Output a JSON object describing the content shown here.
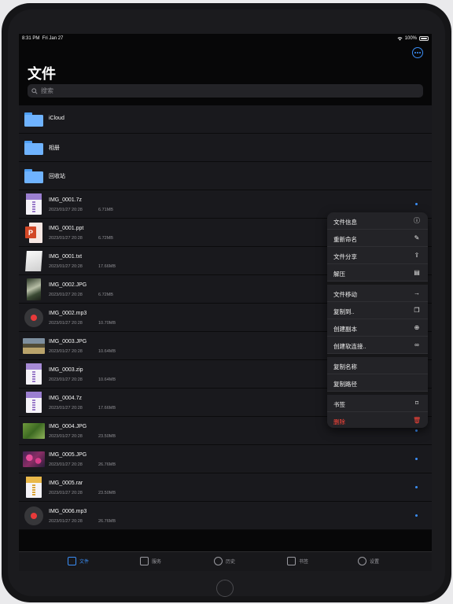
{
  "status_bar": {
    "time": "8:31 PM",
    "date": "Fri Jan 27",
    "battery": "100%"
  },
  "header": {
    "title": "文件",
    "more_icon": "ellipsis-circle-icon"
  },
  "search": {
    "placeholder": "搜索"
  },
  "folders": [
    {
      "name": "iCloud"
    },
    {
      "name": "相册"
    },
    {
      "name": "回收站"
    }
  ],
  "files": [
    {
      "name": "IMG_0001.7z",
      "date": "2023/01/27 20:28",
      "size": "6.71MB",
      "kind": "7z"
    },
    {
      "name": "IMG_0001.ppt",
      "date": "2023/01/27 20:28",
      "size": "6.72MB",
      "kind": "ppt"
    },
    {
      "name": "IMG_0001.txt",
      "date": "2023/01/27 20:28",
      "size": "17.66MB",
      "kind": "txt"
    },
    {
      "name": "IMG_0002.JPG",
      "date": "2023/01/27 20:28",
      "size": "6.72MB",
      "kind": "jpg-tall"
    },
    {
      "name": "IMG_0002.mp3",
      "date": "2023/01/27 20:28",
      "size": "10.70MB",
      "kind": "mp3"
    },
    {
      "name": "IMG_0003.JPG",
      "date": "2023/01/27 20:28",
      "size": "10.64MB",
      "kind": "jpg-landscape"
    },
    {
      "name": "IMG_0003.zip",
      "date": "2023/01/27 20:28",
      "size": "10.64MB",
      "kind": "zip"
    },
    {
      "name": "IMG_0004.7z",
      "date": "2023/01/27 20:28",
      "size": "17.66MB",
      "kind": "7z"
    },
    {
      "name": "IMG_0004.JPG",
      "date": "2023/01/27 20:28",
      "size": "23.50MB",
      "kind": "jpg-grass"
    },
    {
      "name": "IMG_0005.JPG",
      "date": "2023/01/27 20:28",
      "size": "26.76MB",
      "kind": "jpg-flowers"
    },
    {
      "name": "IMG_0005.rar",
      "date": "2023/01/27 20:28",
      "size": "23.50MB",
      "kind": "rar"
    },
    {
      "name": "IMG_0006.mp3",
      "date": "2023/01/27 20:28",
      "size": "26.76MB",
      "kind": "mp3"
    }
  ],
  "context_menu": {
    "groups": [
      [
        {
          "label": "文件信息",
          "icon": "info-circle-icon",
          "glyph": "ⓘ"
        },
        {
          "label": "重新命名",
          "icon": "rename-icon",
          "glyph": "✎"
        },
        {
          "label": "文件分享",
          "icon": "share-icon",
          "glyph": "⇪"
        },
        {
          "label": "解压",
          "icon": "archive-box-icon",
          "glyph": "▤"
        }
      ],
      [
        {
          "label": "文件移动",
          "icon": "arrow-right-icon",
          "glyph": "→"
        },
        {
          "label": "复制到..",
          "icon": "copy-doc-icon",
          "glyph": "❐"
        },
        {
          "label": "创建副本",
          "icon": "doc-plus-icon",
          "glyph": "⊕"
        },
        {
          "label": "创建软连接..",
          "icon": "link-icon",
          "glyph": "∞"
        }
      ],
      [
        {
          "label": "复制名称",
          "icon": "",
          "glyph": ""
        },
        {
          "label": "复制路径",
          "icon": "",
          "glyph": ""
        }
      ],
      [
        {
          "label": "书签",
          "icon": "bookmark-icon",
          "glyph": "⌑"
        },
        {
          "label": "删除",
          "icon": "trash-icon",
          "glyph": "🗑",
          "danger": true
        }
      ]
    ]
  },
  "tabbar": {
    "items": [
      {
        "label": "文件",
        "icon": "document-icon",
        "active": true
      },
      {
        "label": "服务",
        "icon": "server-icon",
        "active": false
      },
      {
        "label": "历史",
        "icon": "clock-icon",
        "active": false
      },
      {
        "label": "书签",
        "icon": "bookmark-icon",
        "active": false
      },
      {
        "label": "设置",
        "icon": "settings-icon",
        "active": false
      }
    ]
  },
  "colors": {
    "accent": "#3b8ef6",
    "danger": "#ff453a",
    "background": "#070708",
    "row": "#19191d"
  }
}
